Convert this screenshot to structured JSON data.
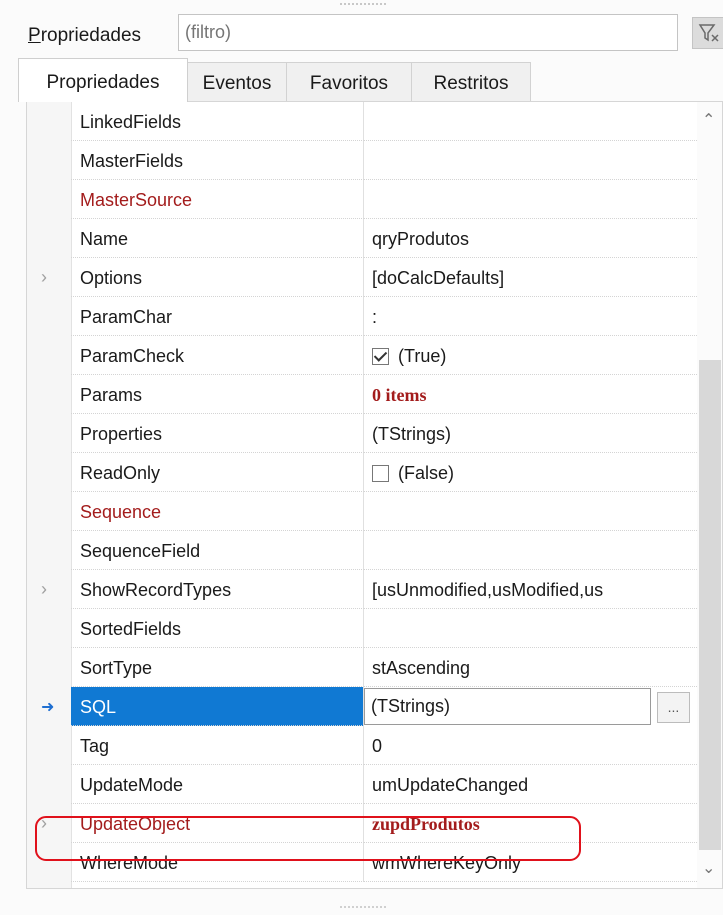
{
  "filter": {
    "label_access": "P",
    "label_rest": "ropriedades",
    "placeholder": "(filtro)"
  },
  "tabs": [
    "Propriedades",
    "Eventos",
    "Favoritos",
    "Restritos"
  ],
  "rows": [
    {
      "name": "LinkedFields",
      "value": ""
    },
    {
      "name": "MasterFields",
      "value": ""
    },
    {
      "name": "MasterSource",
      "value": "",
      "name_color": "red"
    },
    {
      "name": "Name",
      "value": "qryProdutos"
    },
    {
      "name": "Options",
      "value": "[doCalcDefaults]",
      "expandable": true
    },
    {
      "name": "ParamChar",
      "value": ":"
    },
    {
      "name": "ParamCheck",
      "value": "(True)",
      "checkbox": true,
      "checked": true
    },
    {
      "name": "Params",
      "value": "0 items",
      "value_style": "bold-red"
    },
    {
      "name": "Properties",
      "value": "(TStrings)"
    },
    {
      "name": "ReadOnly",
      "value": "(False)",
      "checkbox": true,
      "checked": false
    },
    {
      "name": "Sequence",
      "value": "",
      "name_color": "red"
    },
    {
      "name": "SequenceField",
      "value": ""
    },
    {
      "name": "ShowRecordTypes",
      "value": "[usUnmodified,usModified,us",
      "expandable": true
    },
    {
      "name": "SortedFields",
      "value": ""
    },
    {
      "name": "SortType",
      "value": "stAscending"
    },
    {
      "name": "SQL",
      "value": "(TStrings)",
      "selected": true,
      "ellipsis": "..."
    },
    {
      "name": "Tag",
      "value": "0"
    },
    {
      "name": "UpdateMode",
      "value": "umUpdateChanged"
    },
    {
      "name": "UpdateObject",
      "value": "zupdProdutos",
      "name_color": "red",
      "value_style": "bold-red",
      "expandable": true
    },
    {
      "name": "WhereMode",
      "value": "wmWhereKeyOnly"
    }
  ],
  "icons": {
    "expand": "›",
    "selected_marker": "➜",
    "scroll_up": "⌃",
    "scroll_down": "⌄"
  },
  "colors": {
    "selected_bg": "#1079d3",
    "red_text": "#a31c1c",
    "highlight_border": "#e0111b"
  }
}
